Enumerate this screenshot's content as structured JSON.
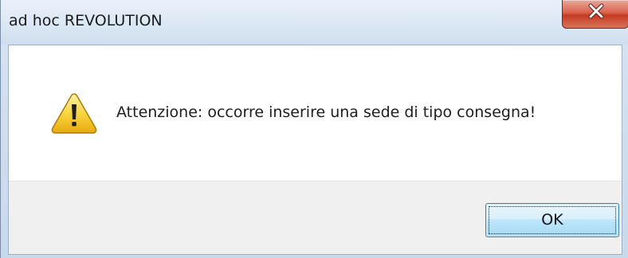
{
  "window": {
    "title": "ad hoc REVOLUTION",
    "close_icon": "close-icon"
  },
  "dialog": {
    "icon": "warning-icon",
    "message": "Attenzione: occorre inserire una sede di tipo consegna!",
    "ok_label": "OK"
  },
  "colors": {
    "close_button": "#c63a22",
    "ok_border": "#3c7fb1",
    "warning_yellow": "#f2c11c"
  }
}
